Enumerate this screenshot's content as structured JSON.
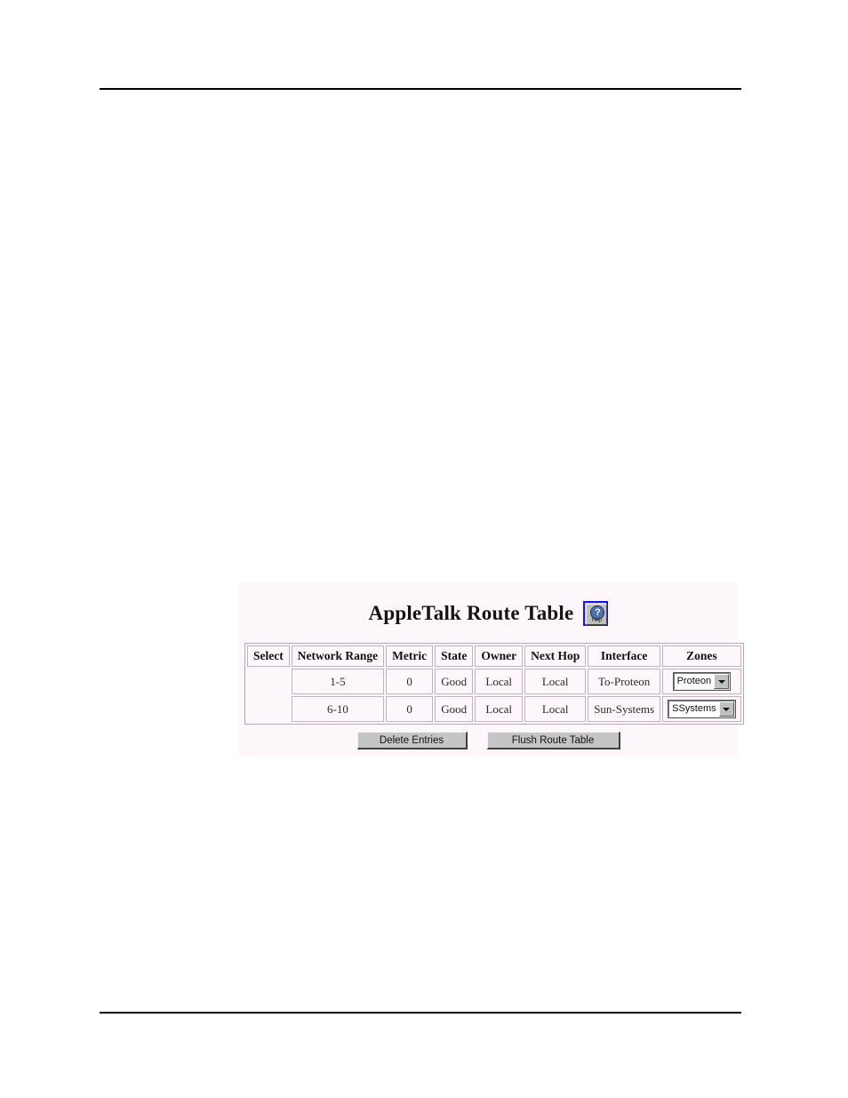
{
  "page": {
    "background": "#ffffff",
    "rule_color": "#000000"
  },
  "screenshot": {
    "background": "#fdf6fa",
    "title": "AppleTalk Route Table",
    "help_button": {
      "icon": "help-question-icon",
      "label": "Help",
      "glyph": "?",
      "border_color": "#1818d8",
      "circle_color": "#4f6fa8"
    },
    "table": {
      "columns": [
        "Select",
        "Network Range",
        "Metric",
        "State",
        "Owner",
        "Next Hop",
        "Interface",
        "Zones"
      ],
      "rows": [
        {
          "select": "",
          "network_range": "1-5",
          "metric": "0",
          "state": "Good",
          "owner": "Local",
          "next_hop": "Local",
          "interface": "To-Proteon",
          "zone": "Proteon"
        },
        {
          "select": "",
          "network_range": "6-10",
          "metric": "0",
          "state": "Good",
          "owner": "Local",
          "next_hop": "Local",
          "interface": "Sun-Systems",
          "zone": "SSystems"
        }
      ]
    },
    "buttons": {
      "delete": "Delete Entries",
      "flush": "Flush Route Table"
    }
  }
}
